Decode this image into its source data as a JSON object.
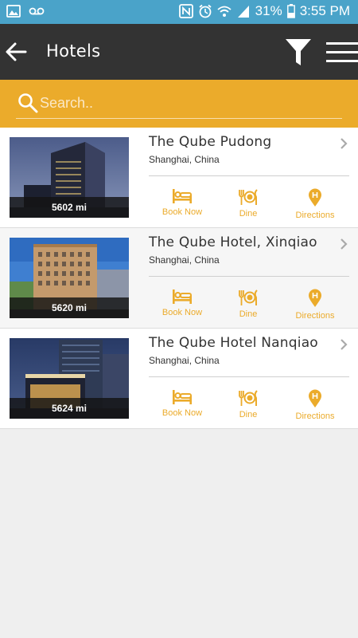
{
  "status_bar": {
    "battery": "31%",
    "time": "3:55 PM"
  },
  "app_bar": {
    "title": "Hotels"
  },
  "search": {
    "placeholder": "Search.."
  },
  "colors": {
    "accent": "#ebab2b",
    "app_bar_bg": "#333333",
    "status_bar_bg": "#4aa3c9"
  },
  "hotels": [
    {
      "name": "The Qube Pudong",
      "location": "Shanghai, China",
      "distance": "5602 mi",
      "actions": {
        "book": "Book Now",
        "dine": "Dine",
        "directions": "Directions"
      }
    },
    {
      "name": "The Qube Hotel, Xinqiao",
      "location": "Shanghai, China",
      "distance": "5620 mi",
      "actions": {
        "book": "Book Now",
        "dine": "Dine",
        "directions": "Directions"
      }
    },
    {
      "name": "The Qube Hotel Nanqiao",
      "location": "Shanghai, China",
      "distance": "5624 mi",
      "actions": {
        "book": "Book Now",
        "dine": "Dine",
        "directions": "Directions"
      }
    }
  ]
}
